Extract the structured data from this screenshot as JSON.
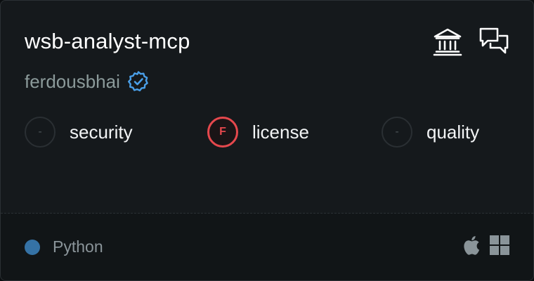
{
  "card": {
    "title": "wsb-analyst-mcp",
    "author": "ferdousbhai",
    "verified_icon": "verified-badge-icon",
    "header_icons": [
      "bank-icon",
      "chat-bubbles-icon"
    ]
  },
  "metrics": [
    {
      "grade": "-",
      "label": "security",
      "status": "empty"
    },
    {
      "grade": "F",
      "label": "license",
      "status": "fail"
    },
    {
      "grade": "-",
      "label": "quality",
      "status": "empty"
    }
  ],
  "footer": {
    "language": "Python",
    "language_color": "#3572A5",
    "platforms": [
      "apple-icon",
      "windows-icon"
    ]
  },
  "colors": {
    "background": "#15191c",
    "accent_verified": "#4a9fe8",
    "fail": "#e5484d"
  }
}
